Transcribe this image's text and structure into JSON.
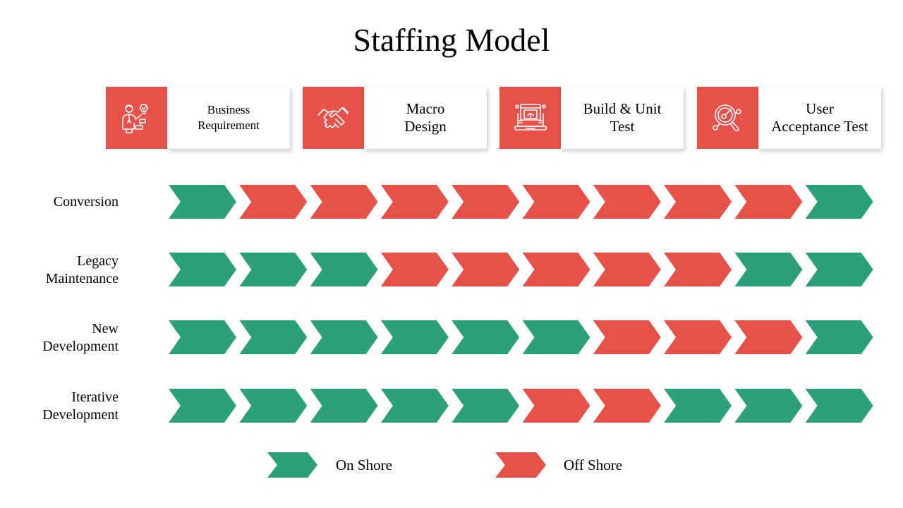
{
  "title": "Staffing Model",
  "colors": {
    "on_shore": "#2BA07A",
    "off_shore": "#E8504A",
    "icon_bg": "#E8504A"
  },
  "phases": [
    {
      "label_line1": "Business",
      "label_line2": "Requirement",
      "icon": "businessman-idea-icon"
    },
    {
      "label_line1": "Macro",
      "label_line2": "Design",
      "icon": "handshake-icon"
    },
    {
      "label_line1": "Build & Unit",
      "label_line2": "Test",
      "icon": "laptop-build-icon"
    },
    {
      "label_line1": "User",
      "label_line2": "Acceptance Test",
      "icon": "target-search-icon"
    }
  ],
  "rows": [
    {
      "label_line1": "Conversion",
      "label_line2": "",
      "cells": [
        "on",
        "off",
        "off",
        "off",
        "off",
        "off",
        "off",
        "off",
        "off",
        "on"
      ]
    },
    {
      "label_line1": "Legacy",
      "label_line2": "Maintenance",
      "cells": [
        "on",
        "on",
        "on",
        "off",
        "off",
        "off",
        "off",
        "off",
        "on",
        "on"
      ]
    },
    {
      "label_line1": "New",
      "label_line2": "Development",
      "cells": [
        "on",
        "on",
        "on",
        "on",
        "on",
        "on",
        "off",
        "off",
        "off",
        "on"
      ]
    },
    {
      "label_line1": "Iterative",
      "label_line2": "Development",
      "cells": [
        "on",
        "on",
        "on",
        "on",
        "on",
        "off",
        "off",
        "on",
        "on",
        "on"
      ]
    }
  ],
  "legend": [
    {
      "key": "on",
      "label": "On Shore"
    },
    {
      "key": "off",
      "label": "Off Shore"
    }
  ]
}
